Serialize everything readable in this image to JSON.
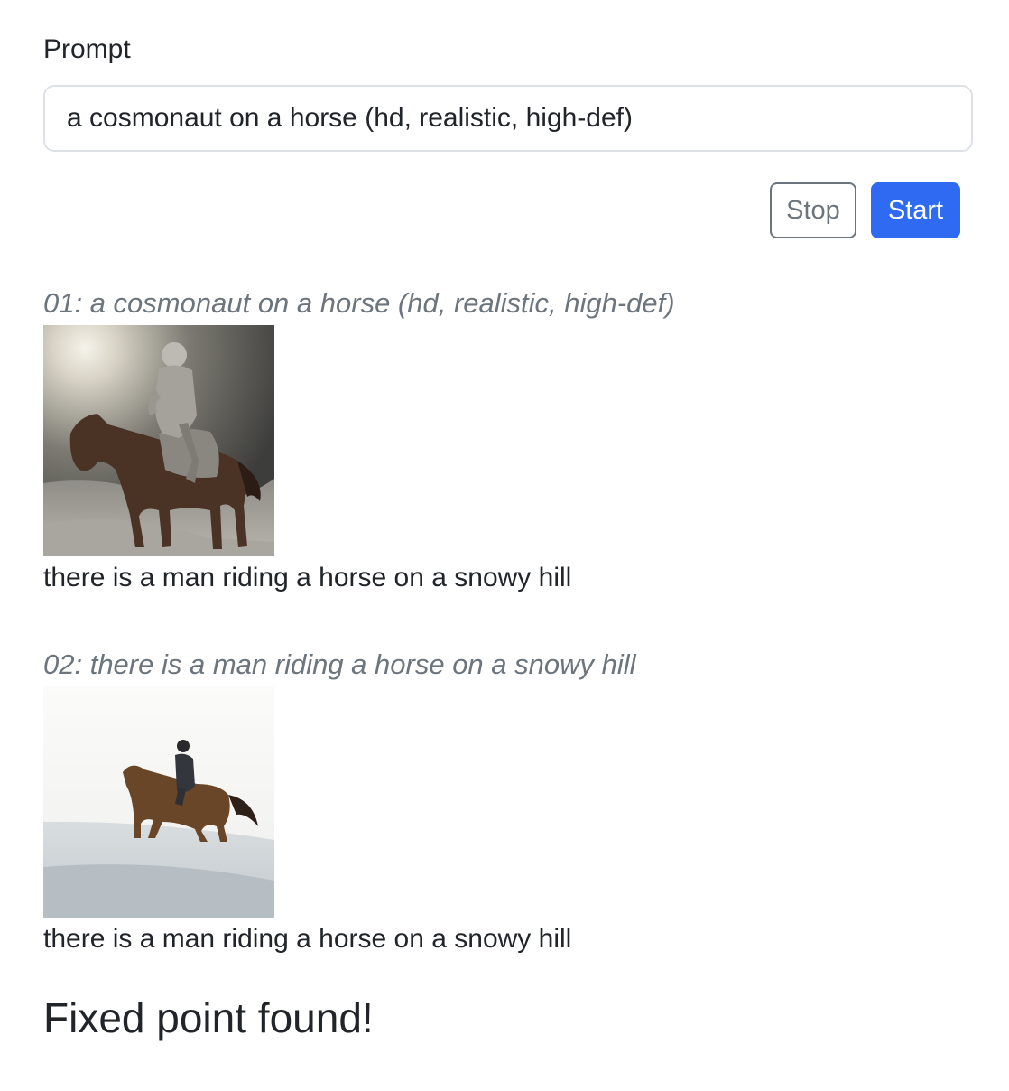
{
  "form": {
    "prompt_label": "Prompt",
    "prompt_value": "a cosmonaut on a horse (hd, realistic, high-def)",
    "stop_label": "Stop",
    "start_label": "Start"
  },
  "steps": [
    {
      "title": "01: a cosmonaut on a horse (hd, realistic, high-def)",
      "caption": "there is a man riding a horse on a snowy hill"
    },
    {
      "title": "02: there is a man riding a horse on a snowy hill",
      "caption": "there is a man riding a horse on a snowy hill"
    }
  ],
  "result": "Fixed point found!",
  "colors": {
    "primary": "#2f6bf2",
    "secondary": "#6c757d",
    "text": "#212529"
  }
}
